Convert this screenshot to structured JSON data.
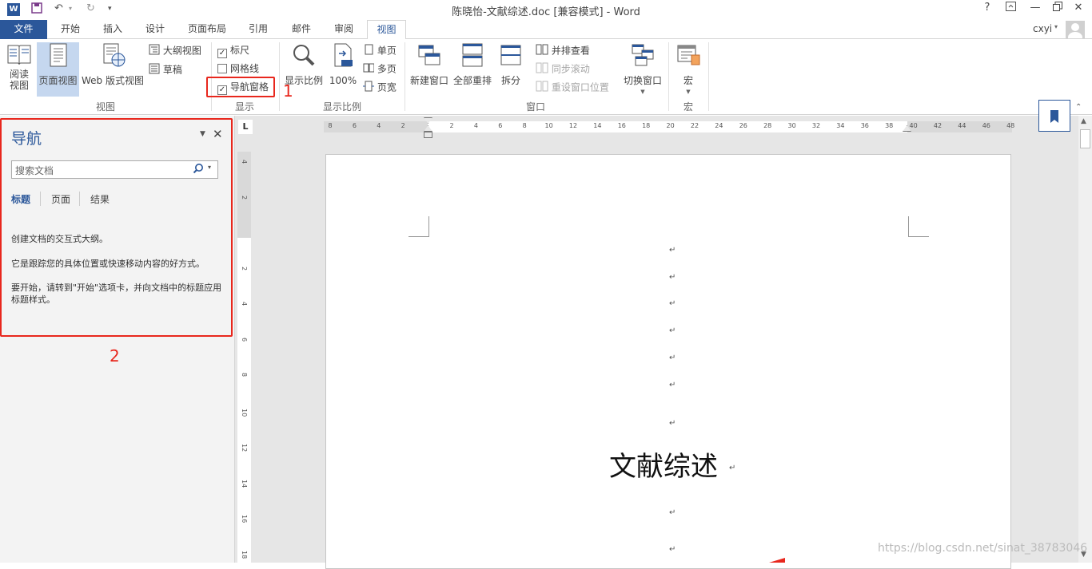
{
  "window": {
    "title": "陈晓怡-文献综述.doc [兼容模式] - Word",
    "help": "?",
    "user": "cxyi"
  },
  "tabs": [
    "文件",
    "开始",
    "插入",
    "设计",
    "页面布局",
    "引用",
    "邮件",
    "审阅",
    "视图"
  ],
  "ribbon": {
    "views": {
      "label": "视图",
      "read_mode": "阅读\n视图",
      "print_layout": "页面视图",
      "web_layout": "Web 版式视图",
      "outline": "大纲视图",
      "draft": "草稿"
    },
    "show": {
      "label": "显示",
      "ruler": "标尺",
      "gridlines": "网格线",
      "nav_pane": "导航窗格",
      "ruler_checked": true,
      "gridlines_checked": false,
      "nav_pane_checked": true
    },
    "zoom": {
      "label": "显示比例",
      "zoom": "显示比例",
      "hundred": "100%",
      "one_page": "单页",
      "multi_page": "多页",
      "page_width": "页宽"
    },
    "window": {
      "label": "窗口",
      "new_window": "新建窗口",
      "arrange_all": "全部重排",
      "split": "拆分",
      "side_by_side": "并排查看",
      "sync_scroll": "同步滚动",
      "reset_position": "重设窗口位置",
      "switch_windows": "切换窗口"
    },
    "macros": {
      "label": "宏",
      "macros": "宏"
    }
  },
  "annotations": {
    "one": "1",
    "two": "2"
  },
  "nav_pane": {
    "title": "导航",
    "search_placeholder": "搜索文档",
    "tabs": [
      "标题",
      "页面",
      "结果"
    ],
    "hint1": "创建文档的交互式大纲。",
    "hint2": "它是跟踪您的具体位置或快速移动内容的好方式。",
    "hint3": "要开始，请转到\"开始\"选项卡，并向文档中的标题应用标题样式。"
  },
  "ruler": {
    "h_ticks": [
      "8",
      "6",
      "4",
      "2",
      "2",
      "4",
      "6",
      "8",
      "10",
      "12",
      "14",
      "16",
      "18",
      "20",
      "22",
      "24",
      "26",
      "28",
      "30",
      "32",
      "34",
      "36",
      "38",
      "40",
      "42",
      "44",
      "46",
      "48"
    ],
    "v_ticks": [
      "4",
      "2",
      "2",
      "4",
      "6",
      "8",
      "10",
      "12",
      "14",
      "16",
      "18"
    ],
    "corner": "L"
  },
  "document": {
    "heading": "文献综述",
    "return_mark": "↵"
  },
  "watermark": "https://blog.csdn.net/sinat_38783046"
}
